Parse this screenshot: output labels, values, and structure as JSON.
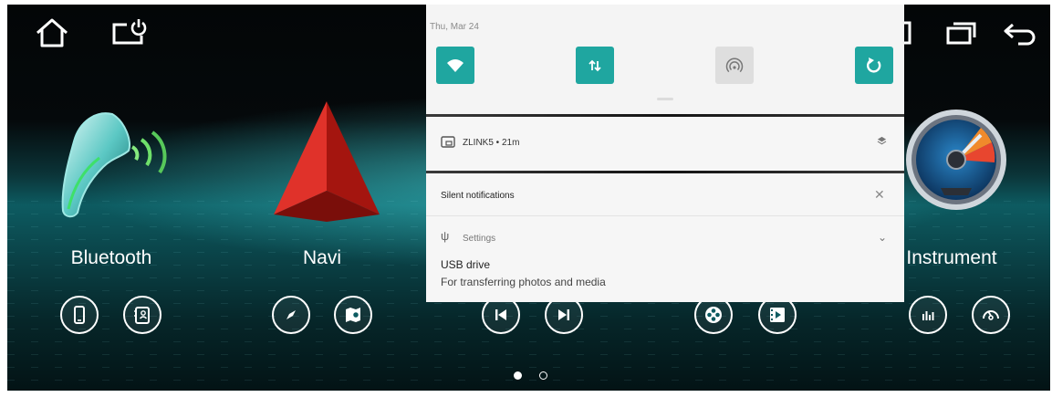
{
  "status": {
    "date": "Thu, Mar 24"
  },
  "quick_settings": {
    "tiles": [
      {
        "name": "wifi",
        "active": true,
        "color": "#1fa6a0"
      },
      {
        "name": "mobile-data",
        "active": true,
        "color": "#1fa6a0"
      },
      {
        "name": "hotspot",
        "active": false,
        "color": "#dedede"
      },
      {
        "name": "auto-rotate",
        "active": true,
        "color": "#1fa6a0"
      }
    ]
  },
  "notifications": {
    "ongoing": {
      "app": "ZLINK5 • 21m"
    },
    "silent_header": "Silent notifications",
    "usb": {
      "app": "Settings",
      "title": "USB drive",
      "body": "For transferring photos and media"
    }
  },
  "apps": [
    {
      "label": "Bluetooth"
    },
    {
      "label": "Navi"
    },
    {
      "label": "Instrument"
    }
  ],
  "pager": {
    "page_count": 2,
    "current": 1
  },
  "colors": {
    "accent": "#1fa6a0",
    "shade_bg": "#f4f4f4"
  }
}
